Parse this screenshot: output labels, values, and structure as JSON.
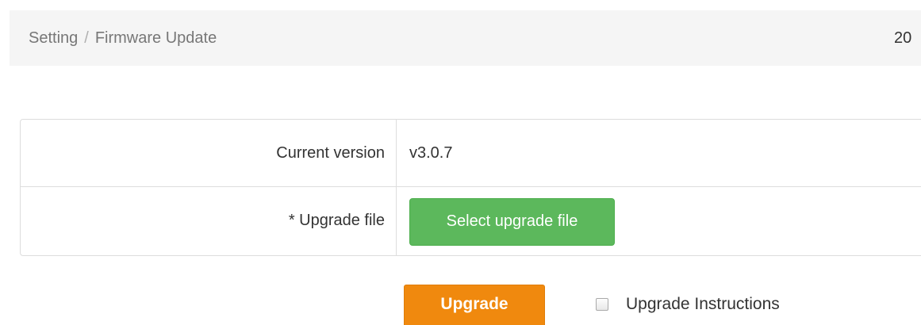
{
  "breadcrumb": {
    "parent": "Setting",
    "separator": "/",
    "current": "Firmware Update",
    "right_text": "20"
  },
  "form": {
    "current_version": {
      "label": "Current version",
      "value": "v3.0.7"
    },
    "upgrade_file": {
      "label": "* Upgrade file",
      "button_label": "Select upgrade file"
    }
  },
  "actions": {
    "upgrade_label": "Upgrade",
    "instructions_label": "Upgrade Instructions",
    "instructions_checked": false
  },
  "colors": {
    "select_button": "#5cb85c",
    "upgrade_button": "#f0890e",
    "breadcrumb_bg": "#f5f5f5"
  }
}
